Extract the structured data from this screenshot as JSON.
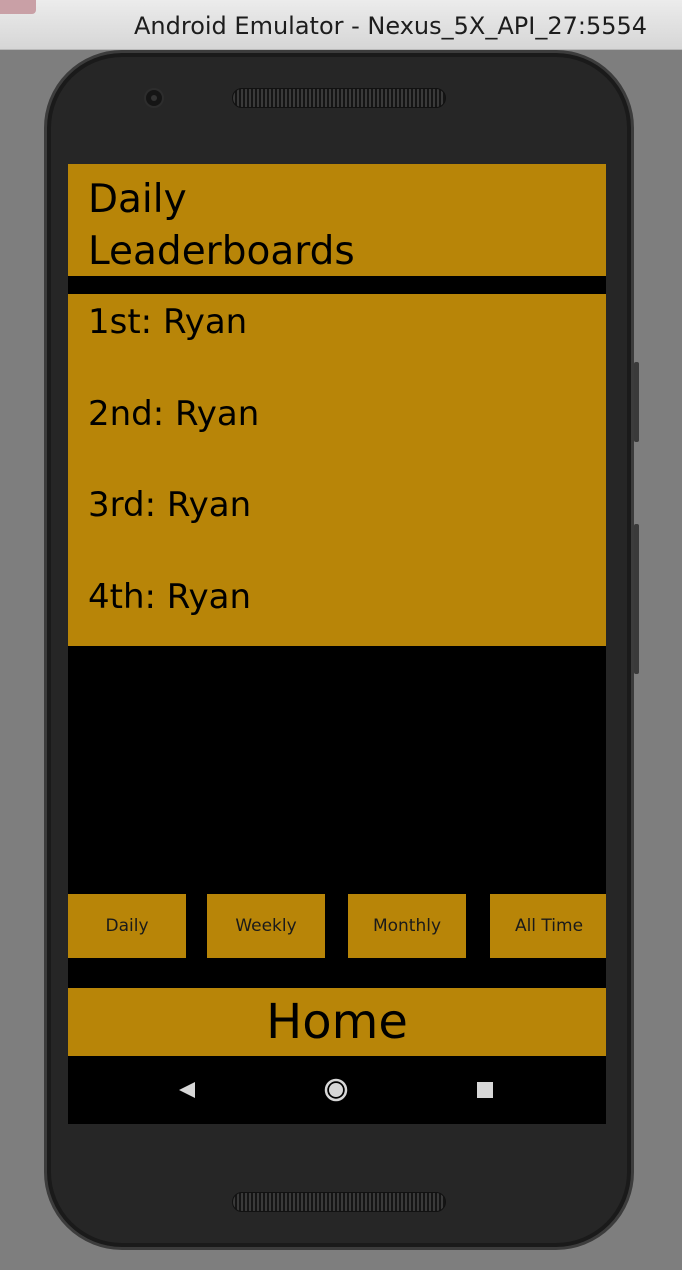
{
  "window": {
    "title": "Android Emulator - Nexus_5X_API_27:5554"
  },
  "colors": {
    "accent": "#b88508",
    "screen_bg": "#000000"
  },
  "header": {
    "title": "Daily Leaderboards"
  },
  "leaderboard": {
    "entries": [
      "1st: Ryan",
      "2nd: Ryan",
      "3rd: Ryan",
      "4th: Ryan"
    ]
  },
  "tabs": {
    "daily": "Daily",
    "weekly": "Weekly",
    "monthly": "Monthly",
    "all_time": "All Time"
  },
  "home_button": {
    "label": "Home"
  },
  "navbar": {
    "icons": [
      "back-icon",
      "home-icon",
      "recents-icon"
    ]
  }
}
